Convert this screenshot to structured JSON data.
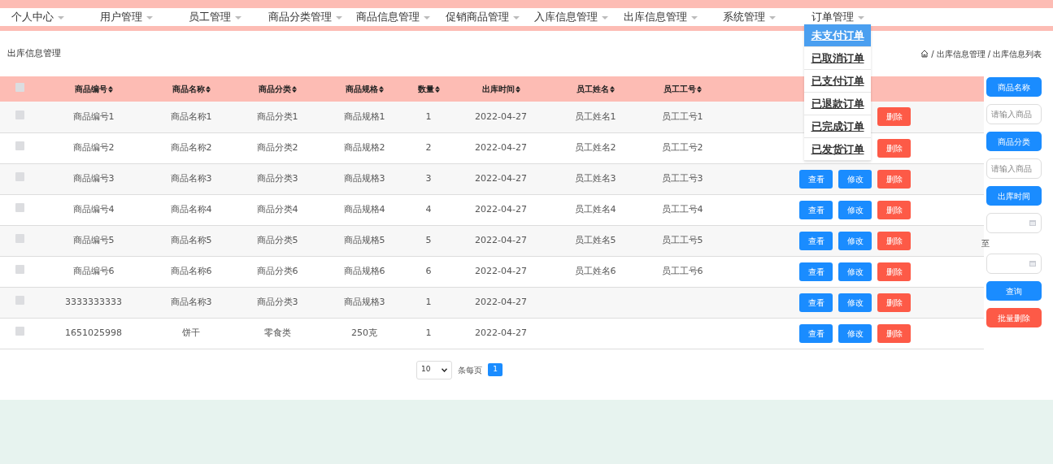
{
  "nav": {
    "items": [
      {
        "label": "个人中心"
      },
      {
        "label": "用户管理"
      },
      {
        "label": "员工管理"
      },
      {
        "label": "商品分类管理"
      },
      {
        "label": "商品信息管理"
      },
      {
        "label": "促销商品管理"
      },
      {
        "label": "入库信息管理"
      },
      {
        "label": "出库信息管理"
      },
      {
        "label": "系统管理"
      },
      {
        "label": "订单管理",
        "menu": [
          {
            "label": "未支付订单",
            "selected": true
          },
          {
            "label": "已取消订单",
            "selected": false
          },
          {
            "label": "已支付订单",
            "selected": false
          },
          {
            "label": "已退款订单",
            "selected": false
          },
          {
            "label": "已完成订单",
            "selected": false
          },
          {
            "label": "已发货订单",
            "selected": false
          }
        ]
      }
    ]
  },
  "page_title": "出库信息管理",
  "breadcrumb": {
    "separator": "/",
    "items": [
      "出库信息管理",
      "出库信息列表"
    ]
  },
  "table": {
    "select_all_checked": false,
    "columns": [
      {
        "label": "商品编号",
        "sortable": true
      },
      {
        "label": "商品名称",
        "sortable": true
      },
      {
        "label": "商品分类",
        "sortable": true
      },
      {
        "label": "商品规格",
        "sortable": true
      },
      {
        "label": "数量",
        "sortable": true
      },
      {
        "label": "出库时间",
        "sortable": true
      },
      {
        "label": "员工姓名",
        "sortable": true
      },
      {
        "label": "员工工号",
        "sortable": true
      }
    ],
    "rows": [
      {
        "checked": false,
        "cells": [
          "商品编号1",
          "商品名称1",
          "商品分类1",
          "商品规格1",
          "1",
          "2022-04-27",
          "员工姓名1",
          "员工工号1"
        ],
        "actions": [
          {
            "kind": "delete",
            "label": "删除"
          }
        ]
      },
      {
        "checked": false,
        "cells": [
          "商品编号2",
          "商品名称2",
          "商品分类2",
          "商品规格2",
          "2",
          "2022-04-27",
          "员工姓名2",
          "员工工号2"
        ],
        "actions": [
          {
            "kind": "delete",
            "label": "删除"
          }
        ]
      },
      {
        "checked": false,
        "cells": [
          "商品编号3",
          "商品名称3",
          "商品分类3",
          "商品规格3",
          "3",
          "2022-04-27",
          "员工姓名3",
          "员工工号3"
        ],
        "actions": [
          {
            "kind": "view",
            "label": "查看"
          },
          {
            "kind": "edit",
            "label": "修改"
          },
          {
            "kind": "delete",
            "label": "删除"
          }
        ]
      },
      {
        "checked": false,
        "cells": [
          "商品编号4",
          "商品名称4",
          "商品分类4",
          "商品规格4",
          "4",
          "2022-04-27",
          "员工姓名4",
          "员工工号4"
        ],
        "actions": [
          {
            "kind": "view",
            "label": "查看"
          },
          {
            "kind": "edit",
            "label": "修改"
          },
          {
            "kind": "delete",
            "label": "删除"
          }
        ]
      },
      {
        "checked": false,
        "cells": [
          "商品编号5",
          "商品名称5",
          "商品分类5",
          "商品规格5",
          "5",
          "2022-04-27",
          "员工姓名5",
          "员工工号5"
        ],
        "actions": [
          {
            "kind": "view",
            "label": "查看"
          },
          {
            "kind": "edit",
            "label": "修改"
          },
          {
            "kind": "delete",
            "label": "删除"
          }
        ]
      },
      {
        "checked": false,
        "cells": [
          "商品编号6",
          "商品名称6",
          "商品分类6",
          "商品规格6",
          "6",
          "2022-04-27",
          "员工姓名6",
          "员工工号6"
        ],
        "actions": [
          {
            "kind": "view",
            "label": "查看"
          },
          {
            "kind": "edit",
            "label": "修改"
          },
          {
            "kind": "delete",
            "label": "删除"
          }
        ]
      },
      {
        "checked": false,
        "cells": [
          "3333333333",
          "商品名称3",
          "商品分类3",
          "商品规格3",
          "1",
          "2022-04-27",
          "",
          ""
        ],
        "actions": [
          {
            "kind": "view",
            "label": "查看"
          },
          {
            "kind": "edit",
            "label": "修改"
          },
          {
            "kind": "delete",
            "label": "删除"
          }
        ]
      },
      {
        "checked": false,
        "cells": [
          "1651025998",
          "饼干",
          "零食类",
          "250克",
          "1",
          "2022-04-27",
          "",
          ""
        ],
        "actions": [
          {
            "kind": "view",
            "label": "查看"
          },
          {
            "kind": "edit",
            "label": "修改"
          },
          {
            "kind": "delete",
            "label": "删除"
          }
        ]
      }
    ]
  },
  "search_panel": [
    {
      "kind": "label",
      "text": "商品名称"
    },
    {
      "kind": "input",
      "placeholder": "请输入商品"
    },
    {
      "kind": "label",
      "text": "商品分类"
    },
    {
      "kind": "input",
      "placeholder": "请输入商品"
    },
    {
      "kind": "label",
      "text": "出库时间"
    },
    {
      "kind": "date"
    },
    {
      "kind": "text",
      "text": "至"
    },
    {
      "kind": "date"
    },
    {
      "kind": "search",
      "text": "查询"
    },
    {
      "kind": "danger",
      "text": "批量删除"
    }
  ],
  "pagination": {
    "page_size": "10",
    "per_page_label": "条每页",
    "pages": [
      {
        "label": "1",
        "selected": true
      }
    ]
  }
}
